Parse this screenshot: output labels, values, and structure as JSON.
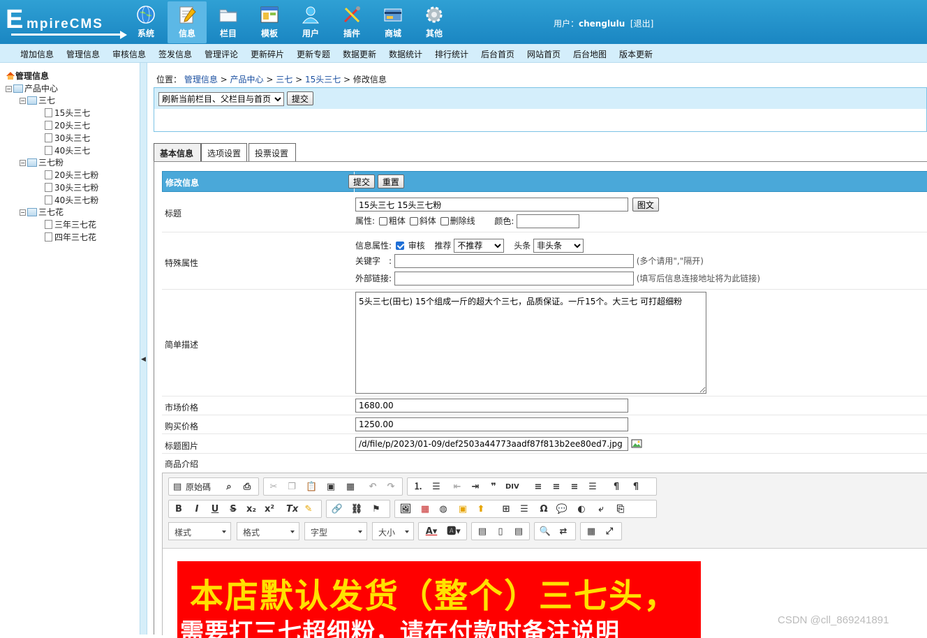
{
  "logo": {
    "big": "E",
    "small": "mpireCMS"
  },
  "nav": [
    {
      "label": "系统",
      "icon": "globe-icon"
    },
    {
      "label": "信息",
      "icon": "notepad-icon"
    },
    {
      "label": "栏目",
      "icon": "folder-icon"
    },
    {
      "label": "模板",
      "icon": "window-icon"
    },
    {
      "label": "用户",
      "icon": "user-icon"
    },
    {
      "label": "插件",
      "icon": "tools-icon"
    },
    {
      "label": "商城",
      "icon": "card-icon"
    },
    {
      "label": "其他",
      "icon": "gear-icon"
    }
  ],
  "user": {
    "prefix": "用户：",
    "name": "chenglulu",
    "logout": "[退出]"
  },
  "menu": [
    "增加信息",
    "管理信息",
    "审核信息",
    "签发信息",
    "管理评论",
    "更新碎片",
    "更新专题",
    "数据更新",
    "数据统计",
    "排行统计",
    "后台首页",
    "网站首页",
    "后台地图",
    "版本更新"
  ],
  "sidebar": {
    "title": "管理信息",
    "root": "产品中心",
    "groups": [
      {
        "name": "三七",
        "items": [
          "15头三七",
          "20头三七",
          "30头三七",
          "40头三七"
        ]
      },
      {
        "name": "三七粉",
        "items": [
          "20头三七粉",
          "30头三七粉",
          "40头三七粉"
        ]
      },
      {
        "name": "三七花",
        "items": [
          "三年三七花",
          "四年三七花"
        ]
      }
    ]
  },
  "breadcrumb": {
    "prefix": "位置：",
    "links": [
      "管理信息",
      "产品中心",
      "三七",
      "15头三七"
    ],
    "current": "修改信息",
    "sep": " > "
  },
  "refresh": {
    "option": "刷新当前栏目、父栏目与首页",
    "submit": "提交"
  },
  "tabs": [
    "基本信息",
    "选项设置",
    "投票设置"
  ],
  "form": {
    "header": "修改信息",
    "submit": "提交",
    "reset": "重置",
    "title_label": "标题",
    "title_value": "15头三七 15头三七粉",
    "title_pic_btn": "图文",
    "attr_label": "属性:",
    "attr_bold": "粗体",
    "attr_italic": "斜体",
    "attr_strike": "删除线",
    "color_label": "颜色:",
    "special_label": "特殊属性",
    "info_attr": "信息属性:",
    "audit": "审核",
    "recommend_label": "推荐",
    "recommend_value": "不推荐",
    "headline_label": "头条",
    "headline_value": "非头条",
    "keyword_label": "关键字　:",
    "keyword_hint": "(多个请用\",\"隔开)",
    "link_label": "外部链接:",
    "link_hint": "(填写后信息连接地址将为此链接)",
    "desc_label": "简单描述",
    "desc_value": "5头三七(田七) 15个组成一斤的超大个三七，品质保证。一斤15个。大三七 可打超细粉",
    "market_label": "市场价格",
    "market_value": "1680.00",
    "buy_label": "购买价格",
    "buy_value": "1250.00",
    "pic_label": "标题图片",
    "pic_value": "/d/file/p/2023/01-09/def2503a44773aadf87f813b2ee80ed7.jpg",
    "intro_label": "商品介绍"
  },
  "editor": {
    "source": "原始碼",
    "combos": [
      "樣式",
      "格式",
      "字型",
      "大小"
    ],
    "banner_line1": "本店默认发货（整个）三七头，",
    "banner_line2": "需要打三七超细粉，请在付款时备注说明"
  },
  "watermark": "CSDN @cll_869241891"
}
